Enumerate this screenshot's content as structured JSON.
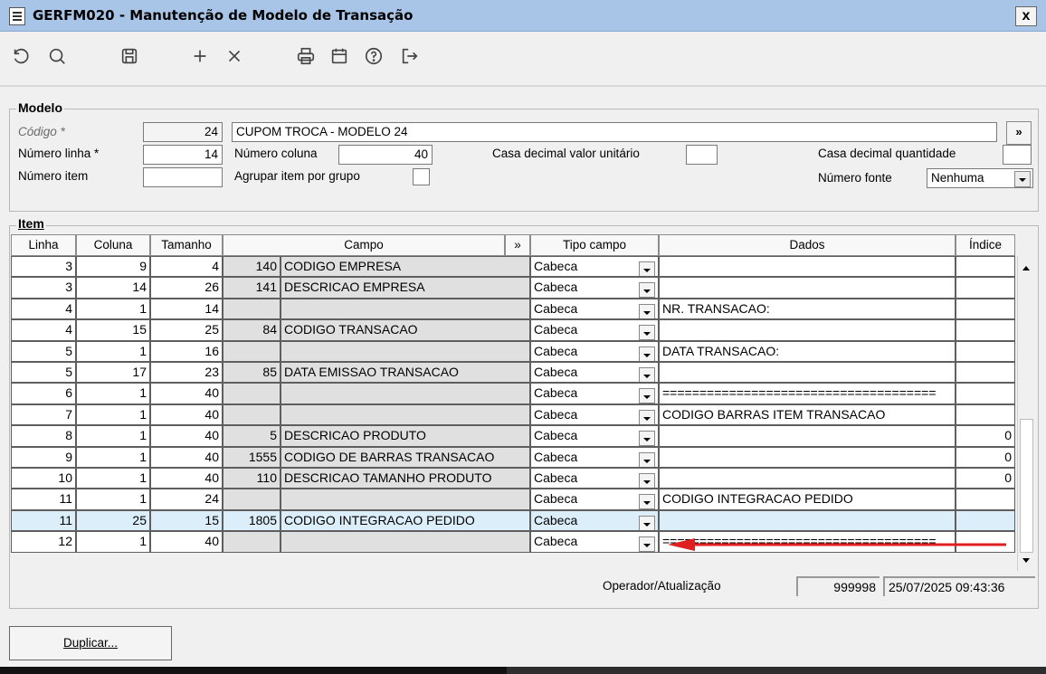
{
  "window": {
    "title": "GERFM020 - Manutenção de Modelo de Transação",
    "close": "x"
  },
  "toolbar": {
    "icons": [
      "refresh-icon",
      "search-icon",
      "save-icon",
      "add-icon",
      "delete-icon",
      "print-icon",
      "calendar-icon",
      "help-icon",
      "exit-icon"
    ]
  },
  "modelo": {
    "group": "Modelo",
    "codigo_label": "Código *",
    "codigo_value": "24",
    "descricao_value": "CUPOM TROCA - MODELO 24",
    "more_btn": "»",
    "numero_linha_label": "Número linha *",
    "numero_linha_value": "14",
    "numero_coluna_label": "Número coluna",
    "numero_coluna_value": "40",
    "casa_dec_valor_label": "Casa decimal valor unitário",
    "casa_dec_valor_value": "",
    "casa_dec_qtd_label": "Casa decimal quantidade",
    "casa_dec_qtd_value": "",
    "numero_item_label": "Número item",
    "numero_item_value": "",
    "agrupar_label": "Agrupar item por grupo",
    "numero_fonte_label": "Número fonte",
    "numero_fonte_value": "Nenhuma"
  },
  "item": {
    "group": "Item",
    "headers": {
      "linha": "Linha",
      "coluna": "Coluna",
      "tamanho": "Tamanho",
      "campo": "Campo",
      "campo_more": "»",
      "tipo": "Tipo campo",
      "dados": "Dados",
      "indice": "Índice"
    },
    "rows": [
      {
        "linha": "3",
        "coluna": "9",
        "tamanho": "4",
        "cod": "140",
        "campo": "CODIGO EMPRESA",
        "tipo": "Cabeca",
        "dados": "",
        "indice": ""
      },
      {
        "linha": "3",
        "coluna": "14",
        "tamanho": "26",
        "cod": "141",
        "campo": "DESCRICAO EMPRESA",
        "tipo": "Cabeca",
        "dados": "",
        "indice": ""
      },
      {
        "linha": "4",
        "coluna": "1",
        "tamanho": "14",
        "cod": "",
        "campo": "",
        "tipo": "Cabeca",
        "dados": "NR. TRANSACAO:",
        "indice": ""
      },
      {
        "linha": "4",
        "coluna": "15",
        "tamanho": "25",
        "cod": "84",
        "campo": "CODIGO TRANSACAO",
        "tipo": "Cabeca",
        "dados": "",
        "indice": ""
      },
      {
        "linha": "5",
        "coluna": "1",
        "tamanho": "16",
        "cod": "",
        "campo": "",
        "tipo": "Cabeca",
        "dados": "DATA TRANSACAO:",
        "indice": ""
      },
      {
        "linha": "5",
        "coluna": "17",
        "tamanho": "23",
        "cod": "85",
        "campo": "DATA EMISSAO TRANSACAO",
        "tipo": "Cabeca",
        "dados": "",
        "indice": ""
      },
      {
        "linha": "6",
        "coluna": "1",
        "tamanho": "40",
        "cod": "",
        "campo": "",
        "tipo": "Cabeca",
        "dados": "=====================================",
        "indice": ""
      },
      {
        "linha": "7",
        "coluna": "1",
        "tamanho": "40",
        "cod": "",
        "campo": "",
        "tipo": "Cabeca",
        "dados": "CODIGO BARRAS ITEM TRANSACAO",
        "indice": ""
      },
      {
        "linha": "8",
        "coluna": "1",
        "tamanho": "40",
        "cod": "5",
        "campo": "DESCRICAO PRODUTO",
        "tipo": "Cabeca",
        "dados": "",
        "indice": "0"
      },
      {
        "linha": "9",
        "coluna": "1",
        "tamanho": "40",
        "cod": "1555",
        "campo": "CODIGO DE BARRAS TRANSACAO",
        "tipo": "Cabeca",
        "dados": "",
        "indice": "0"
      },
      {
        "linha": "10",
        "coluna": "1",
        "tamanho": "40",
        "cod": "110",
        "campo": "DESCRICAO TAMANHO PRODUTO",
        "tipo": "Cabeca",
        "dados": "",
        "indice": "0"
      },
      {
        "linha": "11",
        "coluna": "1",
        "tamanho": "24",
        "cod": "",
        "campo": "",
        "tipo": "Cabeca",
        "dados": "CODIGO INTEGRACAO PEDIDO",
        "indice": ""
      },
      {
        "linha": "11",
        "coluna": "25",
        "tamanho": "15",
        "cod": "1805",
        "campo": "CODIGO INTEGRACAO PEDIDO",
        "tipo": "Cabeca",
        "dados": "",
        "indice": "",
        "selected": true
      },
      {
        "linha": "12",
        "coluna": "1",
        "tamanho": "40",
        "cod": "",
        "campo": "",
        "tipo": "Cabeca",
        "dados": "=====================================",
        "indice": ""
      }
    ]
  },
  "footer": {
    "operador_label": "Operador/Atualização",
    "operador_value": "999998",
    "data_value": "25/07/2025 09:43:36"
  },
  "actions": {
    "duplicar": "Duplicar..."
  },
  "colors": {
    "titlebar": "#a8c4e6",
    "selected_row": "#dceefa",
    "arrow": "#e02020"
  }
}
